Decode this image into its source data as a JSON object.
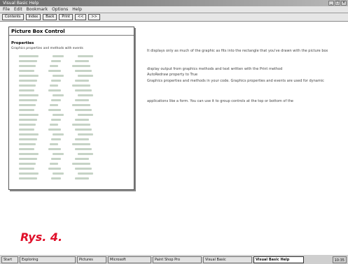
{
  "window": {
    "title": "Visual Basic Help"
  },
  "menubar": {
    "items": [
      "File",
      "Edit",
      "Bookmark",
      "Options",
      "Help"
    ]
  },
  "toolbar": {
    "buttons": [
      "Contents",
      "Index",
      "Back",
      "Print",
      "<<",
      ">>"
    ]
  },
  "panel": {
    "title": "Picture Box Control",
    "section": "Properties",
    "description": "Graphics properties and methods with events",
    "rows": 26
  },
  "topic": {
    "line1": "It displays only as much of the graphic as fits into the rectangle that you've drawn with the picture box",
    "line2": "display output from graphics methods and text written with the Print method",
    "line3": "AutoRedraw property to True",
    "line4": "Graphics properties and methods in your code. Graphics properties and events are used for dynamic",
    "line5": "applications like a form. You can use it to group controls at the top or bottom of the"
  },
  "caption": {
    "label": "Rys. 4."
  },
  "taskbar": {
    "items": [
      "Start",
      "Exploring",
      "Pictures",
      "Microsoft",
      "Paint Shop Pro",
      "Visual Basic",
      "Visual Basic Help"
    ],
    "active_index": 6,
    "clock": "10:35"
  }
}
